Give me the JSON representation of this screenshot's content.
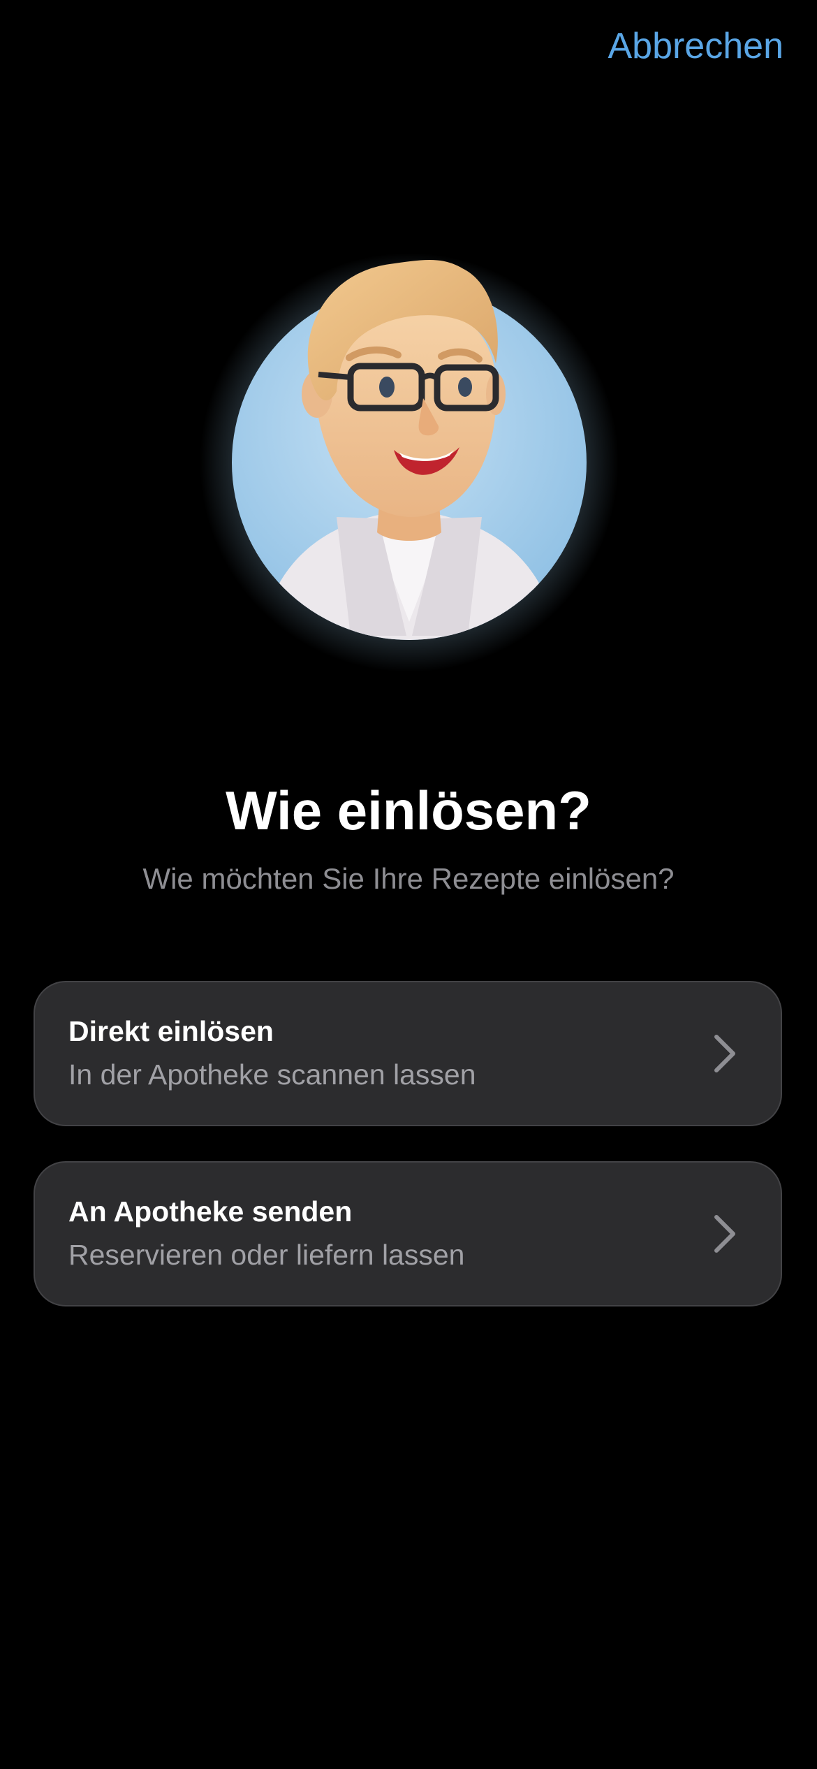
{
  "header": {
    "cancel_label": "Abbrechen"
  },
  "avatar": {
    "icon": "pharmacist-avatar",
    "background_color": "#a9cfea",
    "glow_color": "#9fd0f0"
  },
  "main": {
    "title": "Wie einlösen?",
    "subtitle": "Wie möchten Sie Ihre Rezepte einlösen?"
  },
  "options": [
    {
      "title": "Direkt einlösen",
      "subtitle": "In der Apotheke scannen lassen",
      "icon": "chevron-right-icon"
    },
    {
      "title": "An Apotheke senden",
      "subtitle": "Reservieren oder liefern lassen",
      "icon": "chevron-right-icon"
    }
  ],
  "colors": {
    "background": "#000000",
    "accent": "#5aa6e6",
    "card_background": "#2c2c2e",
    "secondary_text": "#8e8e93"
  }
}
